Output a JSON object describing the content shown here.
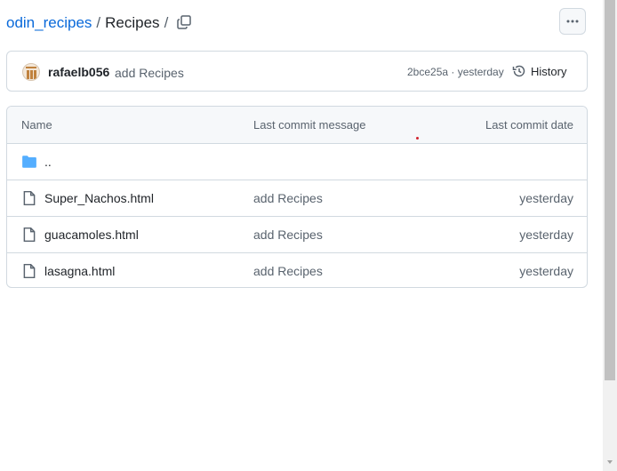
{
  "breadcrumb": {
    "repo": "odin_recipes",
    "separator": "/",
    "folder": "Recipes",
    "trailing_separator": "/"
  },
  "commit": {
    "author": "rafaelb056",
    "message": "add Recipes",
    "hash_time": "2bce25a · yesterday",
    "history_label": "History"
  },
  "table": {
    "headers": {
      "name": "Name",
      "message": "Last commit message",
      "date": "Last commit date"
    },
    "parent_label": "..",
    "files": [
      {
        "name": "Super_Nachos.html",
        "message": "add Recipes",
        "date": "yesterday"
      },
      {
        "name": "guacamoles.html",
        "message": "add Recipes",
        "date": "yesterday"
      },
      {
        "name": "lasagna.html",
        "message": "add Recipes",
        "date": "yesterday"
      }
    ]
  },
  "icons": {
    "copy": "copy-icon",
    "more": "kebab-horizontal-icon",
    "history": "history-icon",
    "folder": "folder-icon",
    "file": "file-icon"
  },
  "colors": {
    "link": "#0969da",
    "folder": "#54aeff",
    "border": "#d1d9e0",
    "muted": "#59636e"
  }
}
